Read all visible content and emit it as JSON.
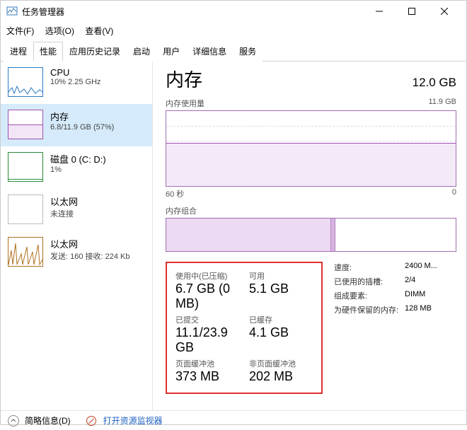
{
  "window": {
    "title": "任务管理器"
  },
  "menu": {
    "file": "文件(F)",
    "options": "选项(O)",
    "view": "查看(V)"
  },
  "tabs": {
    "processes": "进程",
    "performance": "性能",
    "apphistory": "应用历史记录",
    "startup": "启动",
    "users": "用户",
    "details": "详细信息",
    "services": "服务"
  },
  "sidebar": {
    "cpu": {
      "title": "CPU",
      "sub": "10%  2.25 GHz"
    },
    "memory": {
      "title": "内存",
      "sub": "6.8/11.9 GB (57%)"
    },
    "disk": {
      "title": "磁盘 0 (C: D:)",
      "sub": "1%"
    },
    "eth1": {
      "title": "以太网",
      "sub": "未连接"
    },
    "eth2": {
      "title": "以太网",
      "sub": "发送: 160  接收: 224 Kb"
    }
  },
  "detail": {
    "title": "内存",
    "total": "12.0 GB",
    "usage_label": "内存使用量",
    "usage_max": "11.9 GB",
    "x_left": "60 秒",
    "x_right": "0",
    "comp_label": "内存组合",
    "stats": {
      "inuse_label": "使用中(已压缩)",
      "inuse_val": "6.7 GB (0 MB)",
      "avail_label": "可用",
      "avail_val": "5.1 GB",
      "commit_label": "已提交",
      "commit_val": "11.1/23.9 GB",
      "cached_label": "已缓存",
      "cached_val": "4.1 GB",
      "paged_label": "页面缓冲池",
      "paged_val": "373 MB",
      "nonpaged_label": "非页面缓冲池",
      "nonpaged_val": "202 MB"
    },
    "meta": {
      "speed_label": "速度:",
      "speed_val": "2400 M...",
      "slots_label": "已使用的插槽:",
      "slots_val": "2/4",
      "form_label": "组成要素:",
      "form_val": "DIMM",
      "hw_label": "为硬件保留的内存:",
      "hw_val": "128 MB"
    }
  },
  "footer": {
    "brief": "简略信息(D)",
    "openmon": "打开资源监视器"
  },
  "chart_data": {
    "type": "area",
    "title": "内存使用量",
    "ylabel": "GB",
    "ylim": [
      0,
      11.9
    ],
    "x_seconds": [
      60,
      50,
      40,
      30,
      20,
      10,
      0
    ],
    "values_gb": [
      6.9,
      6.9,
      6.85,
      6.8,
      6.8,
      6.8,
      6.8
    ],
    "composition": {
      "type": "stacked-bar",
      "segments": [
        {
          "name": "使用中",
          "value_gb": 6.8
        },
        {
          "name": "已压缩",
          "value_gb": 0.2
        },
        {
          "name": "可用/缓存",
          "value_gb": 4.9
        }
      ],
      "total_gb": 11.9
    }
  }
}
